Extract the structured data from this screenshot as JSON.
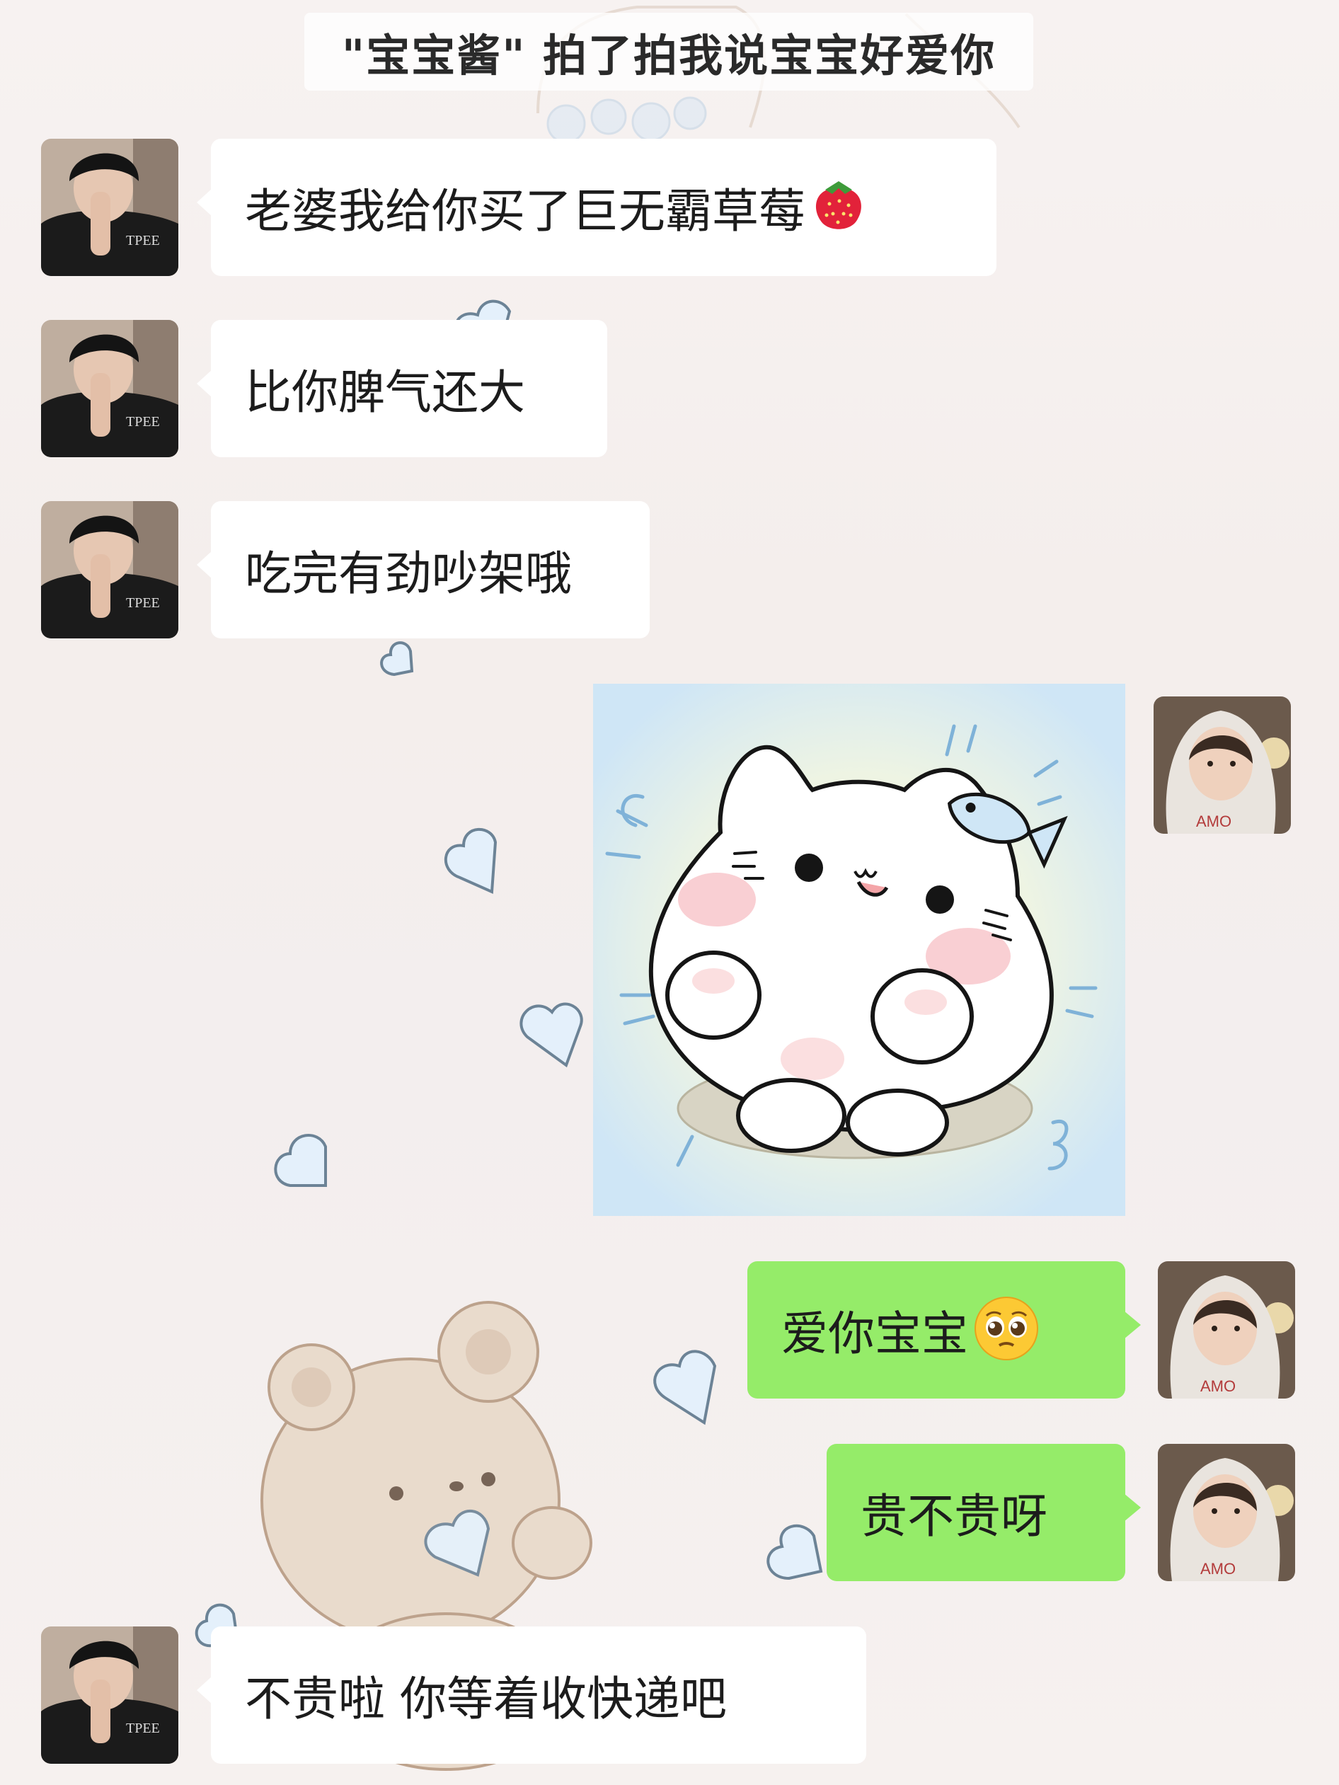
{
  "notice": {
    "text": "\"宝宝酱\" 拍了拍我说宝宝好爱你"
  },
  "messages": [
    {
      "side": "left",
      "text": "老婆我给你买了巨无霸草莓",
      "emoji": "strawberry-icon"
    },
    {
      "side": "left",
      "text": "比你脾气还大"
    },
    {
      "side": "left",
      "text": "吃完有劲吵架哦"
    },
    {
      "side": "right",
      "type": "sticker",
      "sticker": "white-cat-with-fish-sticker"
    },
    {
      "side": "right",
      "text": "爱你宝宝",
      "emoji": "pleading-face-icon"
    },
    {
      "side": "right",
      "text": "贵不贵呀"
    },
    {
      "side": "left",
      "text": "不贵啦 你等着收快递吧"
    }
  ],
  "colors": {
    "my_bubble": "#95ec69",
    "their_bubble": "#ffffff",
    "background": "#f5efed"
  }
}
